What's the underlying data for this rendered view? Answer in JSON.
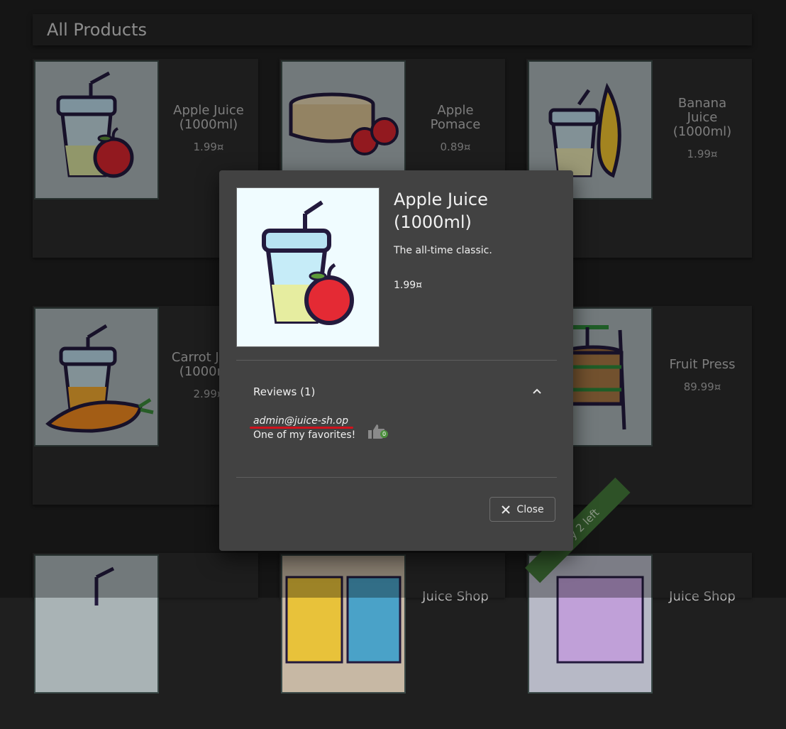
{
  "page": {
    "title": "All Products"
  },
  "products": [
    {
      "name": "Apple Juice (1000ml)",
      "price": "1.99¤"
    },
    {
      "name": "Apple Pomace",
      "price": "0.89¤"
    },
    {
      "name": "Banana Juice (1000ml)",
      "price": "1.99¤"
    },
    {
      "name": "Carrot Juice (1000ml)",
      "price": "2.99¤"
    },
    {
      "name": "Fruit Press",
      "price": "89.99¤"
    },
    {
      "name": "Juice Shop",
      "price": ""
    },
    {
      "name": "Juice Shop",
      "price": ""
    }
  ],
  "ribbon": {
    "label": "Only 2 left"
  },
  "dialog": {
    "title": "Apple Juice (1000ml)",
    "description": "The all-time classic.",
    "price": "1.99¤",
    "reviews_label": "Reviews (1)",
    "reviews": [
      {
        "author": "admin@juice-sh.op",
        "text": "One of my favorites!",
        "likes": "0"
      }
    ],
    "close_label": "Close"
  },
  "colors": {
    "accent_underline": "#d0121c",
    "like_badge": "#4b8e3c",
    "ribbon": "#447a3a"
  }
}
